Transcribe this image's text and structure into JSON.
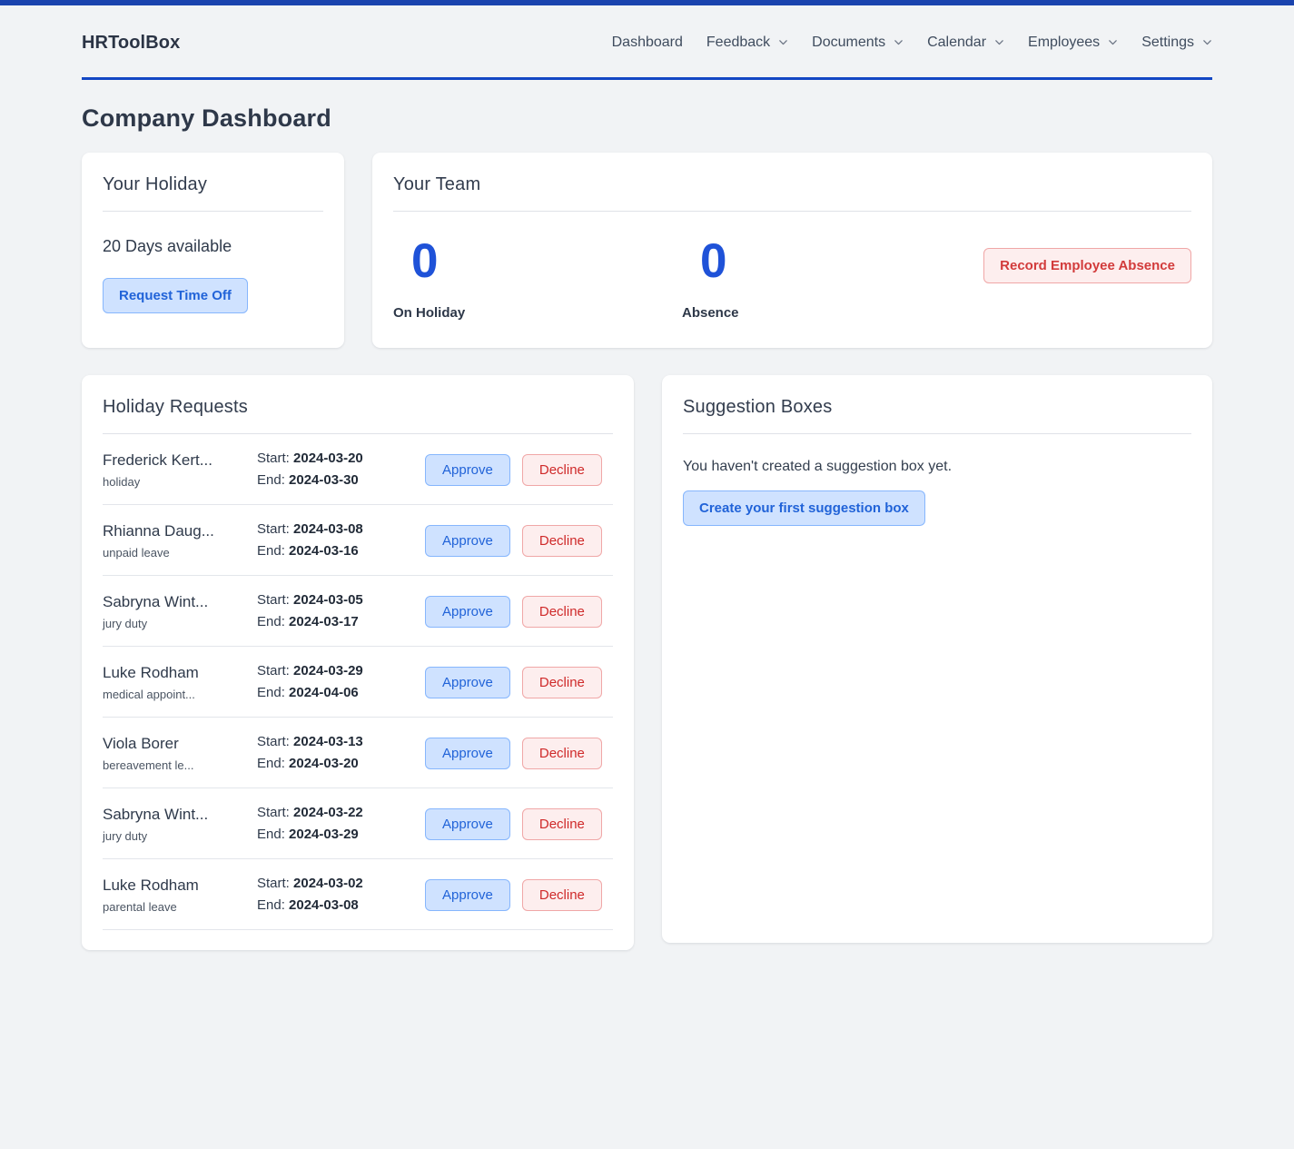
{
  "topbar_color": "#1a43ae",
  "header": {
    "brand": "HRToolBox",
    "nav": [
      {
        "label": "Dashboard",
        "has_caret": false
      },
      {
        "label": "Feedback",
        "has_caret": true
      },
      {
        "label": "Documents",
        "has_caret": true
      },
      {
        "label": "Calendar",
        "has_caret": true
      },
      {
        "label": "Employees",
        "has_caret": true
      },
      {
        "label": "Settings",
        "has_caret": true
      }
    ]
  },
  "page": {
    "title": "Company Dashboard"
  },
  "holiday_card": {
    "title": "Your Holiday",
    "days_available": "20 Days available",
    "request_button": "Request Time Off"
  },
  "team_card": {
    "title": "Your Team",
    "stats": [
      {
        "value": "0",
        "label": "On Holiday"
      },
      {
        "value": "0",
        "label": "Absence"
      }
    ],
    "record_button": "Record Employee Absence",
    "accent_color": "#1f52d8",
    "danger_color": "#d23b3b"
  },
  "requests_card": {
    "title": "Holiday Requests",
    "start_label": "Start:",
    "end_label": "End:",
    "approve_label": "Approve",
    "decline_label": "Decline",
    "rows": [
      {
        "name": "Frederick Kert...",
        "type": "holiday",
        "start": "2024-03-20",
        "end": "2024-03-30"
      },
      {
        "name": "Rhianna Daug...",
        "type": "unpaid leave",
        "start": "2024-03-08",
        "end": "2024-03-16"
      },
      {
        "name": "Sabryna Wint...",
        "type": "jury duty",
        "start": "2024-03-05",
        "end": "2024-03-17"
      },
      {
        "name": "Luke Rodham",
        "type": "medical appoint...",
        "start": "2024-03-29",
        "end": "2024-04-06"
      },
      {
        "name": "Viola Borer",
        "type": "bereavement le...",
        "start": "2024-03-13",
        "end": "2024-03-20"
      },
      {
        "name": "Sabryna Wint...",
        "type": "jury duty",
        "start": "2024-03-22",
        "end": "2024-03-29"
      },
      {
        "name": "Luke Rodham",
        "type": "parental leave",
        "start": "2024-03-02",
        "end": "2024-03-08"
      }
    ]
  },
  "suggestion_card": {
    "title": "Suggestion Boxes",
    "empty_text": "You haven't created a suggestion box yet.",
    "create_button": "Create your first suggestion box"
  }
}
